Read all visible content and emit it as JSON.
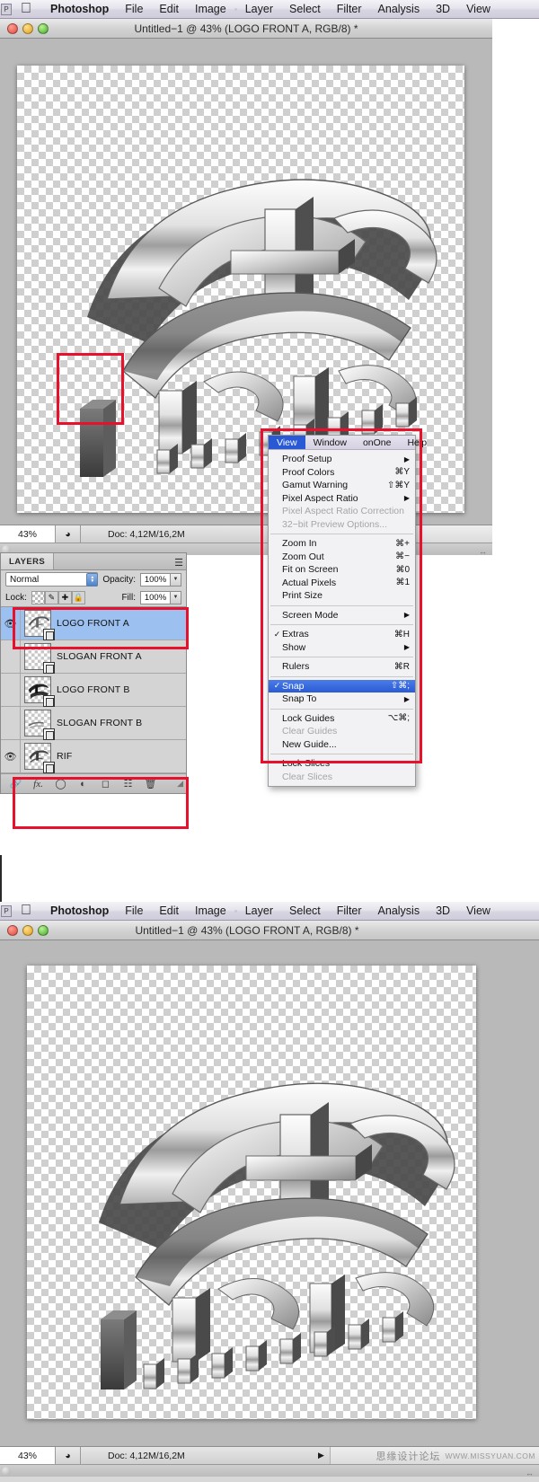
{
  "app": {
    "name": "Photoshop",
    "apple_logo": "apple-icon",
    "badge_letter": "P",
    "menus": [
      "Photoshop",
      "File",
      "Edit",
      "Image",
      "Layer",
      "Select",
      "Filter",
      "Analysis",
      "3D",
      "View"
    ]
  },
  "window_top": {
    "title": "Untitled−1 @ 43% (LOGO FRONT A, RGB/8) *",
    "status": {
      "zoom": "43%",
      "doc_label": "Doc: 4,12M/16,2M",
      "arrow": "▶"
    }
  },
  "window_bottom": {
    "title": "Untitled−1 @ 43% (LOGO FRONT A, RGB/8) *",
    "status": {
      "zoom": "43%",
      "doc_label": "Doc: 4,12M/16,2M",
      "arrow": "▶",
      "watermark_cn": "思缘设计论坛",
      "watermark_url": "WWW.MISSYUAN.COM"
    }
  },
  "layers_panel": {
    "tab_label": "LAYERS",
    "panel_menu_icon": "panel-menu-icon",
    "blend_mode": "Normal",
    "opacity_label": "Opacity:",
    "opacity_value": "100%",
    "lock_label": "Lock:",
    "lock_icons": [
      "transparency-lock-icon",
      "brush-lock-icon",
      "move-lock-icon",
      "all-lock-icon"
    ],
    "fill_label": "Fill:",
    "fill_value": "100%",
    "layers": [
      {
        "name": "LOGO FRONT A",
        "visible": true,
        "selected": true,
        "thumb": "logo-thumb",
        "smart_object": true
      },
      {
        "name": "SLOGAN FRONT A",
        "visible": false,
        "selected": false,
        "thumb": "empty-thumb",
        "smart_object": true
      },
      {
        "name": "LOGO FRONT B",
        "visible": false,
        "selected": false,
        "thumb": "logob-thumb",
        "smart_object": true
      },
      {
        "name": "SLOGAN FRONT B",
        "visible": false,
        "selected": false,
        "thumb": "slogan-thumb",
        "smart_object": true
      },
      {
        "name": "RIF",
        "visible": true,
        "selected": false,
        "thumb": "rif-thumb",
        "smart_object": true
      }
    ],
    "bottom_icons": [
      "link-icon",
      "fx-icon",
      "mask-icon",
      "adjustment-icon",
      "group-icon",
      "new-layer-icon",
      "trash-icon"
    ]
  },
  "view_menu": {
    "header": [
      {
        "label": "View",
        "active": true
      },
      {
        "label": "Window",
        "active": false
      },
      {
        "label": "onOne",
        "active": false
      },
      {
        "label": "Help",
        "active": false
      }
    ],
    "groups": [
      [
        {
          "label": "Proof Setup",
          "key": "",
          "arrow": true,
          "checked": false,
          "disabled": false,
          "selected": false
        },
        {
          "label": "Proof Colors",
          "key": "⌘Y",
          "arrow": false,
          "checked": false,
          "disabled": false,
          "selected": false
        },
        {
          "label": "Gamut Warning",
          "key": "⇧⌘Y",
          "arrow": false,
          "checked": false,
          "disabled": false,
          "selected": false
        },
        {
          "label": "Pixel Aspect Ratio",
          "key": "",
          "arrow": true,
          "checked": false,
          "disabled": false,
          "selected": false
        },
        {
          "label": "Pixel Aspect Ratio Correction",
          "key": "",
          "arrow": false,
          "checked": false,
          "disabled": true,
          "selected": false
        },
        {
          "label": "32−bit Preview Options...",
          "key": "",
          "arrow": false,
          "checked": false,
          "disabled": true,
          "selected": false
        }
      ],
      [
        {
          "label": "Zoom In",
          "key": "⌘+",
          "arrow": false,
          "checked": false,
          "disabled": false,
          "selected": false
        },
        {
          "label": "Zoom Out",
          "key": "⌘−",
          "arrow": false,
          "checked": false,
          "disabled": false,
          "selected": false
        },
        {
          "label": "Fit on Screen",
          "key": "⌘0",
          "arrow": false,
          "checked": false,
          "disabled": false,
          "selected": false
        },
        {
          "label": "Actual Pixels",
          "key": "⌘1",
          "arrow": false,
          "checked": false,
          "disabled": false,
          "selected": false
        },
        {
          "label": "Print Size",
          "key": "",
          "arrow": false,
          "checked": false,
          "disabled": false,
          "selected": false
        }
      ],
      [
        {
          "label": "Screen Mode",
          "key": "",
          "arrow": true,
          "checked": false,
          "disabled": false,
          "selected": false
        }
      ],
      [
        {
          "label": "Extras",
          "key": "⌘H",
          "arrow": false,
          "checked": true,
          "disabled": false,
          "selected": false
        },
        {
          "label": "Show",
          "key": "",
          "arrow": true,
          "checked": false,
          "disabled": false,
          "selected": false
        }
      ],
      [
        {
          "label": "Rulers",
          "key": "⌘R",
          "arrow": false,
          "checked": false,
          "disabled": false,
          "selected": false
        }
      ],
      [
        {
          "label": "Snap",
          "key": "⇧⌘;",
          "arrow": false,
          "checked": true,
          "disabled": false,
          "selected": true
        },
        {
          "label": "Snap To",
          "key": "",
          "arrow": true,
          "checked": false,
          "disabled": false,
          "selected": false
        }
      ],
      [
        {
          "label": "Lock Guides",
          "key": "⌥⌘;",
          "arrow": false,
          "checked": false,
          "disabled": false,
          "selected": false
        },
        {
          "label": "Clear Guides",
          "key": "",
          "arrow": false,
          "checked": false,
          "disabled": true,
          "selected": false
        },
        {
          "label": "New Guide...",
          "key": "",
          "arrow": false,
          "checked": false,
          "disabled": false,
          "selected": false
        }
      ],
      [
        {
          "label": "Lock Slices",
          "key": "",
          "arrow": false,
          "checked": false,
          "disabled": false,
          "selected": false
        },
        {
          "label": "Clear Slices",
          "key": "",
          "arrow": false,
          "checked": false,
          "disabled": true,
          "selected": false
        }
      ]
    ]
  },
  "annotations": {
    "color": "#e8112d",
    "boxes": [
      {
        "name": "canvas-detail-highlight"
      },
      {
        "name": "view-menu-highlight"
      },
      {
        "name": "logo-front-a-layer-highlight"
      },
      {
        "name": "rif-layer-highlight"
      }
    ]
  }
}
